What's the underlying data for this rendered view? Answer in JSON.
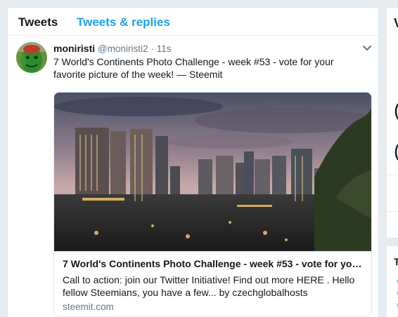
{
  "tabs": {
    "tweets": "Tweets",
    "tweets_replies": "Tweets & replies"
  },
  "tweet": {
    "name": "moniristi",
    "handle": "@moniristi2",
    "separator": "·",
    "time": "11s",
    "text": "7 World's Continents Photo Challenge - week #53 - vote for your favorite picture of the week! — Steemit",
    "avatar_icon": "green-face-avatar"
  },
  "card": {
    "title": "7 World's Continents Photo Challenge - week #53 - vote for your f...",
    "description": "Call to action: join our Twitter Initiative! Find out more HERE . Hello fellow Steemians, you have a few... by czechglobalhosts",
    "domain": "steemit.com",
    "image_icon": "city-skyline-photo"
  },
  "colors": {
    "accent": "#1da1f2",
    "secondary_text": "#657786",
    "border": "#e1e8ed",
    "background": "#e6ecf0"
  }
}
